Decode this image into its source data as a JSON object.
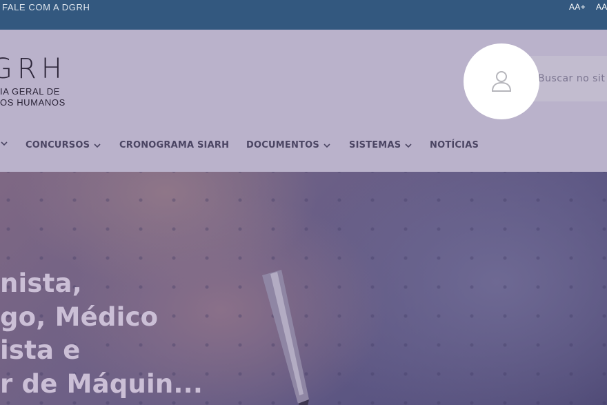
{
  "topbar": {
    "contact_label": "FALE COM A DGRH",
    "font_increase_label": "AA+",
    "font_decrease_label": "AA"
  },
  "logo": {
    "mark": "GRH",
    "line1": "IA GERAL DE",
    "line2": "OS HUMANOS"
  },
  "search": {
    "placeholder": "Buscar no sit"
  },
  "nav": {
    "items": [
      {
        "label": "",
        "has_dropdown": true
      },
      {
        "label": "CONCURSOS",
        "has_dropdown": true
      },
      {
        "label": "CRONOGRAMA SIARH",
        "has_dropdown": false
      },
      {
        "label": "DOCUMENTOS",
        "has_dropdown": true
      },
      {
        "label": "SISTEMAS",
        "has_dropdown": true
      },
      {
        "label": "NOTÍCIAS",
        "has_dropdown": false
      }
    ]
  },
  "hero": {
    "title_lines": [
      "nista,",
      "go, Médico",
      "ista e",
      "r de Máquin..."
    ]
  },
  "icons": {
    "user": "user-icon",
    "chevron": "chevron-down-icon"
  },
  "colors": {
    "topbar": "#33587f",
    "header": "#bab2cb",
    "nav_text": "#4b4563",
    "hero_title": "#cbbfd6"
  }
}
